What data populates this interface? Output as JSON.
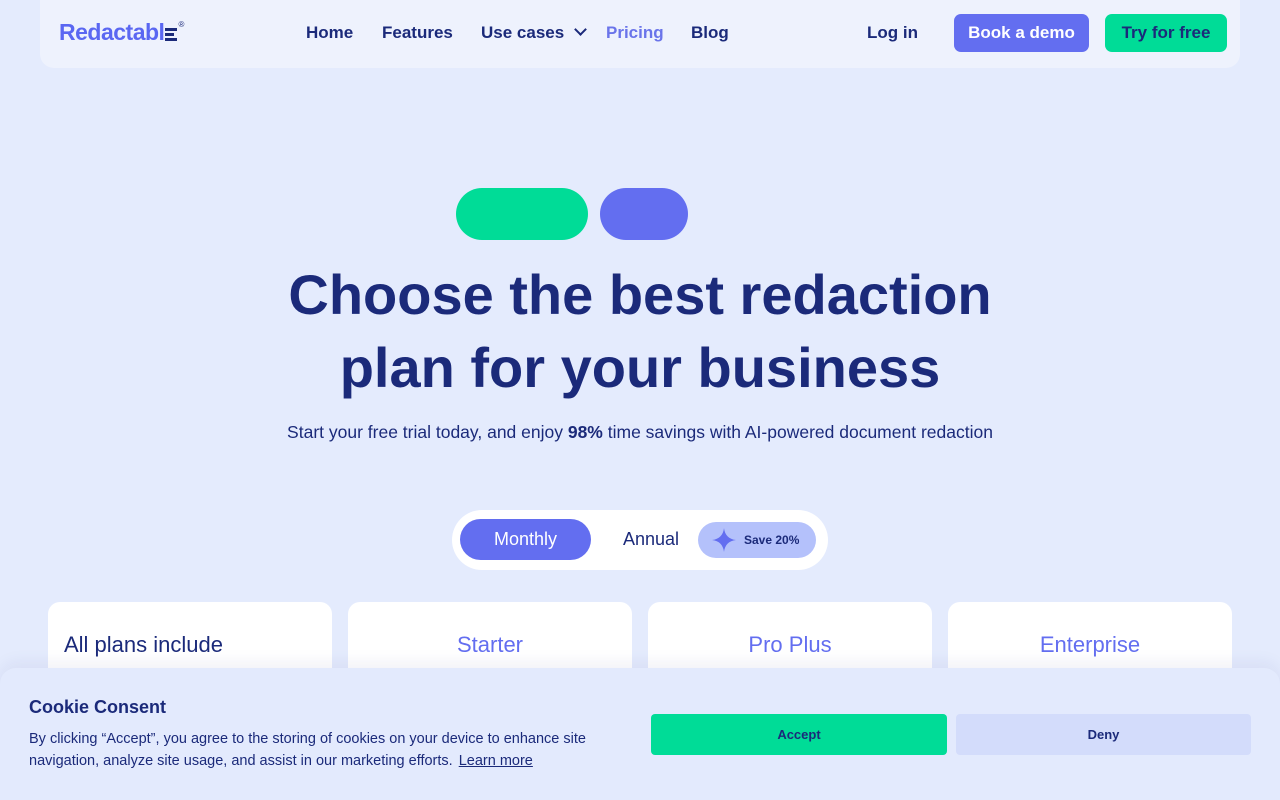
{
  "nav": {
    "logo_text": "Redactabl",
    "logo_registered": "®",
    "links": [
      {
        "label": "Home"
      },
      {
        "label": "Features"
      },
      {
        "label": "Use cases"
      },
      {
        "label": "Pricing"
      },
      {
        "label": "Blog"
      }
    ],
    "login": "Log in",
    "book_demo": "Book a demo",
    "try_free": "Try for free"
  },
  "hero": {
    "title_line1": "Choose the best redaction",
    "title_line2": "plan for your business",
    "subtitle_pre": "Start your free trial today, and enjoy ",
    "subtitle_bold": "98%",
    "subtitle_post": " time savings with AI-powered document redaction"
  },
  "billing_toggle": {
    "monthly": "Monthly",
    "annual": "Annual",
    "save_badge": "Save 20%",
    "selected": "Monthly"
  },
  "plans": [
    {
      "title": "All plans include"
    },
    {
      "title": "Starter"
    },
    {
      "title": "Pro Plus"
    },
    {
      "title": "Enterprise"
    }
  ],
  "cookie": {
    "title": "Cookie Consent",
    "text": "By clicking “Accept”, you agree to the storing of cookies on your device to enhance site navigation, analyze site usage, and assist in our marketing efforts.",
    "learn_more": "Learn more",
    "accept": "Accept",
    "deny": "Deny"
  },
  "colors": {
    "background": "#e4ebfd",
    "navy": "#1b2a7a",
    "indigo": "#636ef0",
    "green": "#00dc97",
    "badge": "#b4c1fb"
  },
  "icons": {
    "nav_dropdown": "chevron-down-icon",
    "save_badge": "sparkle-icon"
  }
}
